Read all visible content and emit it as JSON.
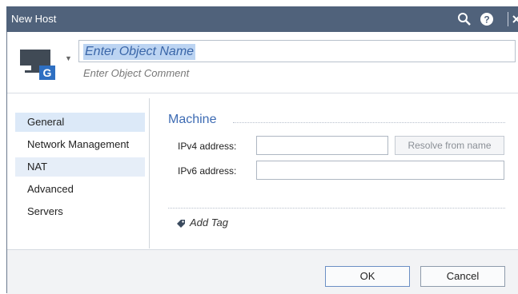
{
  "window": {
    "title": "New Host"
  },
  "header": {
    "name_placeholder": "Enter Object Name",
    "comment_placeholder": "Enter Object Comment",
    "host_icon": "host-gateway-icon"
  },
  "sidebar": {
    "items": [
      {
        "label": "General"
      },
      {
        "label": "Network Management"
      },
      {
        "label": "NAT"
      },
      {
        "label": "Advanced"
      },
      {
        "label": "Servers"
      }
    ]
  },
  "machine": {
    "title": "Machine",
    "ipv4_label": "IPv4 address:",
    "ipv6_label": "IPv6 address:",
    "resolve_label": "Resolve from name"
  },
  "tags": {
    "add_label": "Add Tag"
  },
  "footer": {
    "ok_label": "OK",
    "cancel_label": "Cancel"
  },
  "colors": {
    "titlebar": "#50627b",
    "accent": "#3d6bb3",
    "selection": "#dce9f8"
  }
}
